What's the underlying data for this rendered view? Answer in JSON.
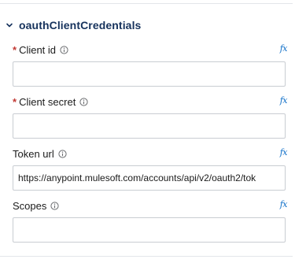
{
  "section": {
    "title": "oauthClientCredentials",
    "expanded": true
  },
  "fields": [
    {
      "label": "Client id",
      "required": true,
      "value": "",
      "info_icon": "info-icon",
      "expr_icon": "𝑓x"
    },
    {
      "label": "Client secret",
      "required": true,
      "value": "",
      "info_icon": "info-icon",
      "expr_icon": "𝑓x"
    },
    {
      "label": "Token url",
      "required": false,
      "value": "https://anypoint.mulesoft.com/accounts/api/v2/oauth2/tok",
      "info_icon": "info-icon",
      "expr_icon": "𝑓x"
    },
    {
      "label": "Scopes",
      "required": false,
      "value": "",
      "info_icon": "info-icon",
      "expr_icon": "𝑓x"
    }
  ],
  "required_marker": "*",
  "colors": {
    "section_title": "#16325c",
    "required": "#c23934",
    "fx": "#0f6fc8",
    "input_border": "#c9cdd2"
  }
}
